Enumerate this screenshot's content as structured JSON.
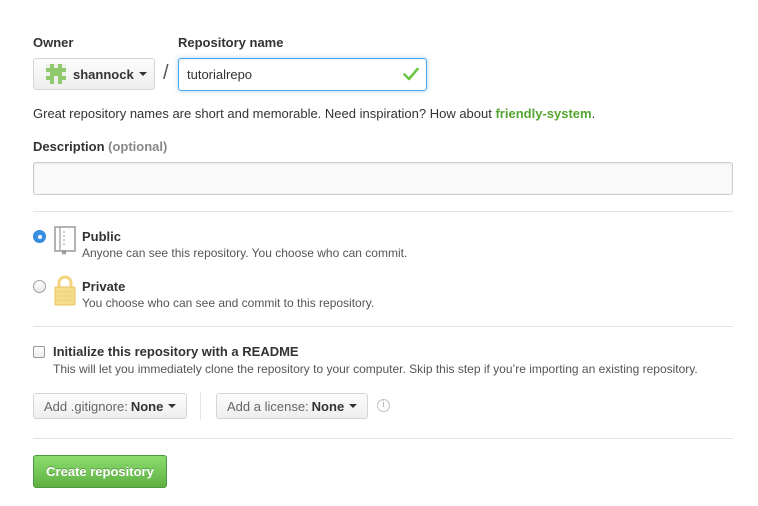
{
  "owner": {
    "label": "Owner",
    "name": "shannock",
    "avatar_icon": "identicon-avatar"
  },
  "separator": "/",
  "repo_name": {
    "label": "Repository name",
    "value": "tutorialrepo",
    "valid_icon": "check-icon"
  },
  "hint": {
    "prefix": "Great repository names are short and memorable. Need inspiration? How about ",
    "suggestion": "friendly-system",
    "suffix": "."
  },
  "description": {
    "label": "Description",
    "optional": "(optional)",
    "value": ""
  },
  "visibility": {
    "public": {
      "title": "Public",
      "desc": "Anyone can see this repository. You choose who can commit.",
      "selected": true,
      "icon": "repo-book-icon"
    },
    "private": {
      "title": "Private",
      "desc": "You choose who can see and commit to this repository.",
      "selected": false,
      "icon": "lock-icon"
    }
  },
  "readme": {
    "label": "Initialize this repository with a README",
    "desc": "This will let you immediately clone the repository to your computer. Skip this step if you’re importing an existing repository.",
    "checked": false
  },
  "gitignore": {
    "label": "Add .gitignore:",
    "value": "None"
  },
  "license": {
    "label": "Add a license:",
    "value": "None"
  },
  "info_icon_glyph": "i",
  "submit": {
    "label": "Create repository"
  },
  "colors": {
    "accent_green": "#55a532",
    "focus_blue": "#51a7e8",
    "button_green": "#60b044"
  }
}
